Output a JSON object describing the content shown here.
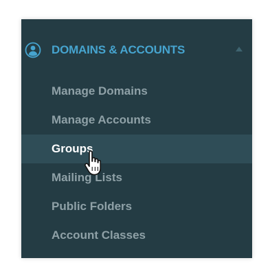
{
  "sidebar": {
    "section": {
      "title": "DOMAINS & ACCOUNTS",
      "icon": "user-circle-icon",
      "expanded": true,
      "title_color": "#46a4cf"
    },
    "items": [
      {
        "label": "Manage Domains",
        "active": false
      },
      {
        "label": "Manage Accounts",
        "active": false
      },
      {
        "label": "Groups",
        "active": true
      },
      {
        "label": "Mailing Lists",
        "active": false
      },
      {
        "label": "Public Folders",
        "active": false
      },
      {
        "label": "Account Classes",
        "active": false
      }
    ],
    "background_color": "#243c44",
    "active_background_color": "#2f4d57"
  },
  "cursor": {
    "icon": "hand-pointer-icon"
  }
}
